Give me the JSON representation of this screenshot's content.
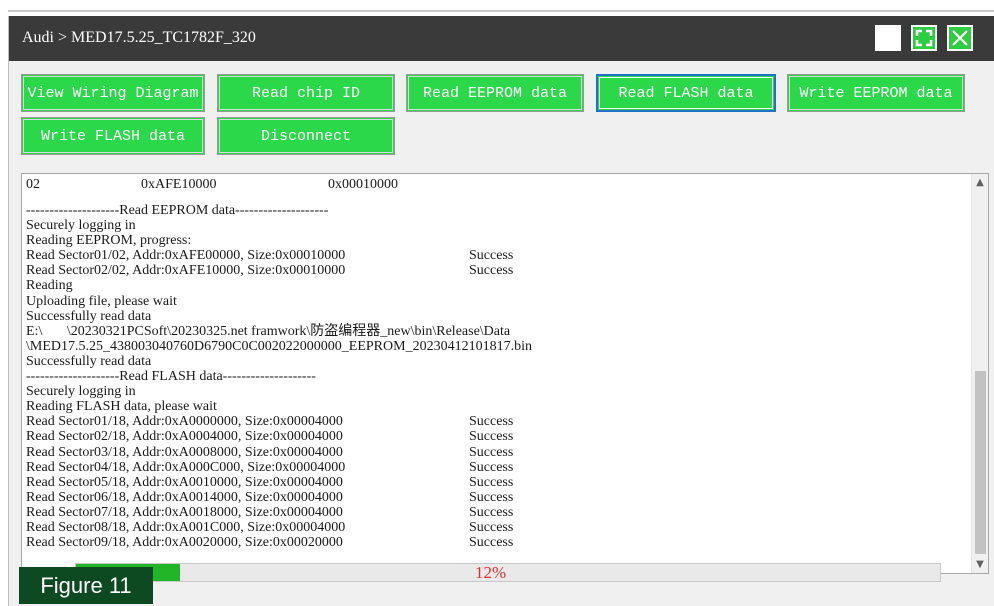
{
  "window": {
    "title": "Audi > MED17.5.25_TC1782F_320",
    "controls": [
      "minimize-icon",
      "maximize-icon",
      "close-icon"
    ],
    "accent_color": "#2bd84a"
  },
  "toolbar": {
    "view_wiring": "View Wiring Diagram",
    "read_chip_id": "Read chip ID",
    "read_eeprom": "Read EEPROM data",
    "read_flash": "Read FLASH data",
    "write_eeprom": "Write EEPROM data",
    "write_flash": "Write FLASH data",
    "disconnect": "Disconnect",
    "selected": "Read FLASH data"
  },
  "log": {
    "header_row": {
      "col1": "02",
      "col2": "0xAFE10000",
      "col3": "0x00010000"
    },
    "lines": [
      "--------------------Read EEPROM data--------------------",
      "Securely logging in",
      "Reading EEPROM, progress:"
    ],
    "eeprom_sectors": [
      {
        "text": "Read Sector01/02, Addr:0xAFE00000, Size:0x00010000",
        "status": "Success"
      },
      {
        "text": "Read Sector02/02, Addr:0xAFE10000, Size:0x00010000",
        "status": "Success"
      }
    ],
    "after_eeprom": [
      "Reading",
      "Uploading file, please wait",
      "Successfully read data",
      "E:\\       \\20230321PCSoft\\20230325.net framwork\\防盗编程器_new\\bin\\Release\\Data",
      "\\MED17.5.25_438003040760D6790C0C002022000000_EEPROM_20230412101817.bin",
      "Successfully read data",
      "--------------------Read FLASH data--------------------",
      "Securely logging in",
      "Reading FLASH data, please wait"
    ],
    "flash_sectors": [
      {
        "text": "Read Sector01/18, Addr:0xA0000000, Size:0x00004000",
        "status": "Success"
      },
      {
        "text": "Read Sector02/18, Addr:0xA0004000, Size:0x00004000",
        "status": "Success"
      },
      {
        "text": "Read Sector03/18, Addr:0xA0008000, Size:0x00004000",
        "status": "Success"
      },
      {
        "text": "Read Sector04/18, Addr:0xA000C000, Size:0x00004000",
        "status": "Success"
      },
      {
        "text": "Read Sector05/18, Addr:0xA0010000, Size:0x00004000",
        "status": "Success"
      },
      {
        "text": "Read Sector06/18, Addr:0xA0014000, Size:0x00004000",
        "status": "Success"
      },
      {
        "text": "Read Sector07/18, Addr:0xA0018000, Size:0x00004000",
        "status": "Success"
      },
      {
        "text": "Read Sector08/18, Addr:0xA001C000, Size:0x00004000",
        "status": "Success"
      },
      {
        "text": "Read Sector09/18, Addr:0xA0020000, Size:0x00020000",
        "status": "Success"
      }
    ]
  },
  "progress": {
    "label": "12%",
    "fraction": 0.12,
    "color": "#22b527",
    "label_color": "#e03030"
  },
  "figure_label": "Figure 11"
}
